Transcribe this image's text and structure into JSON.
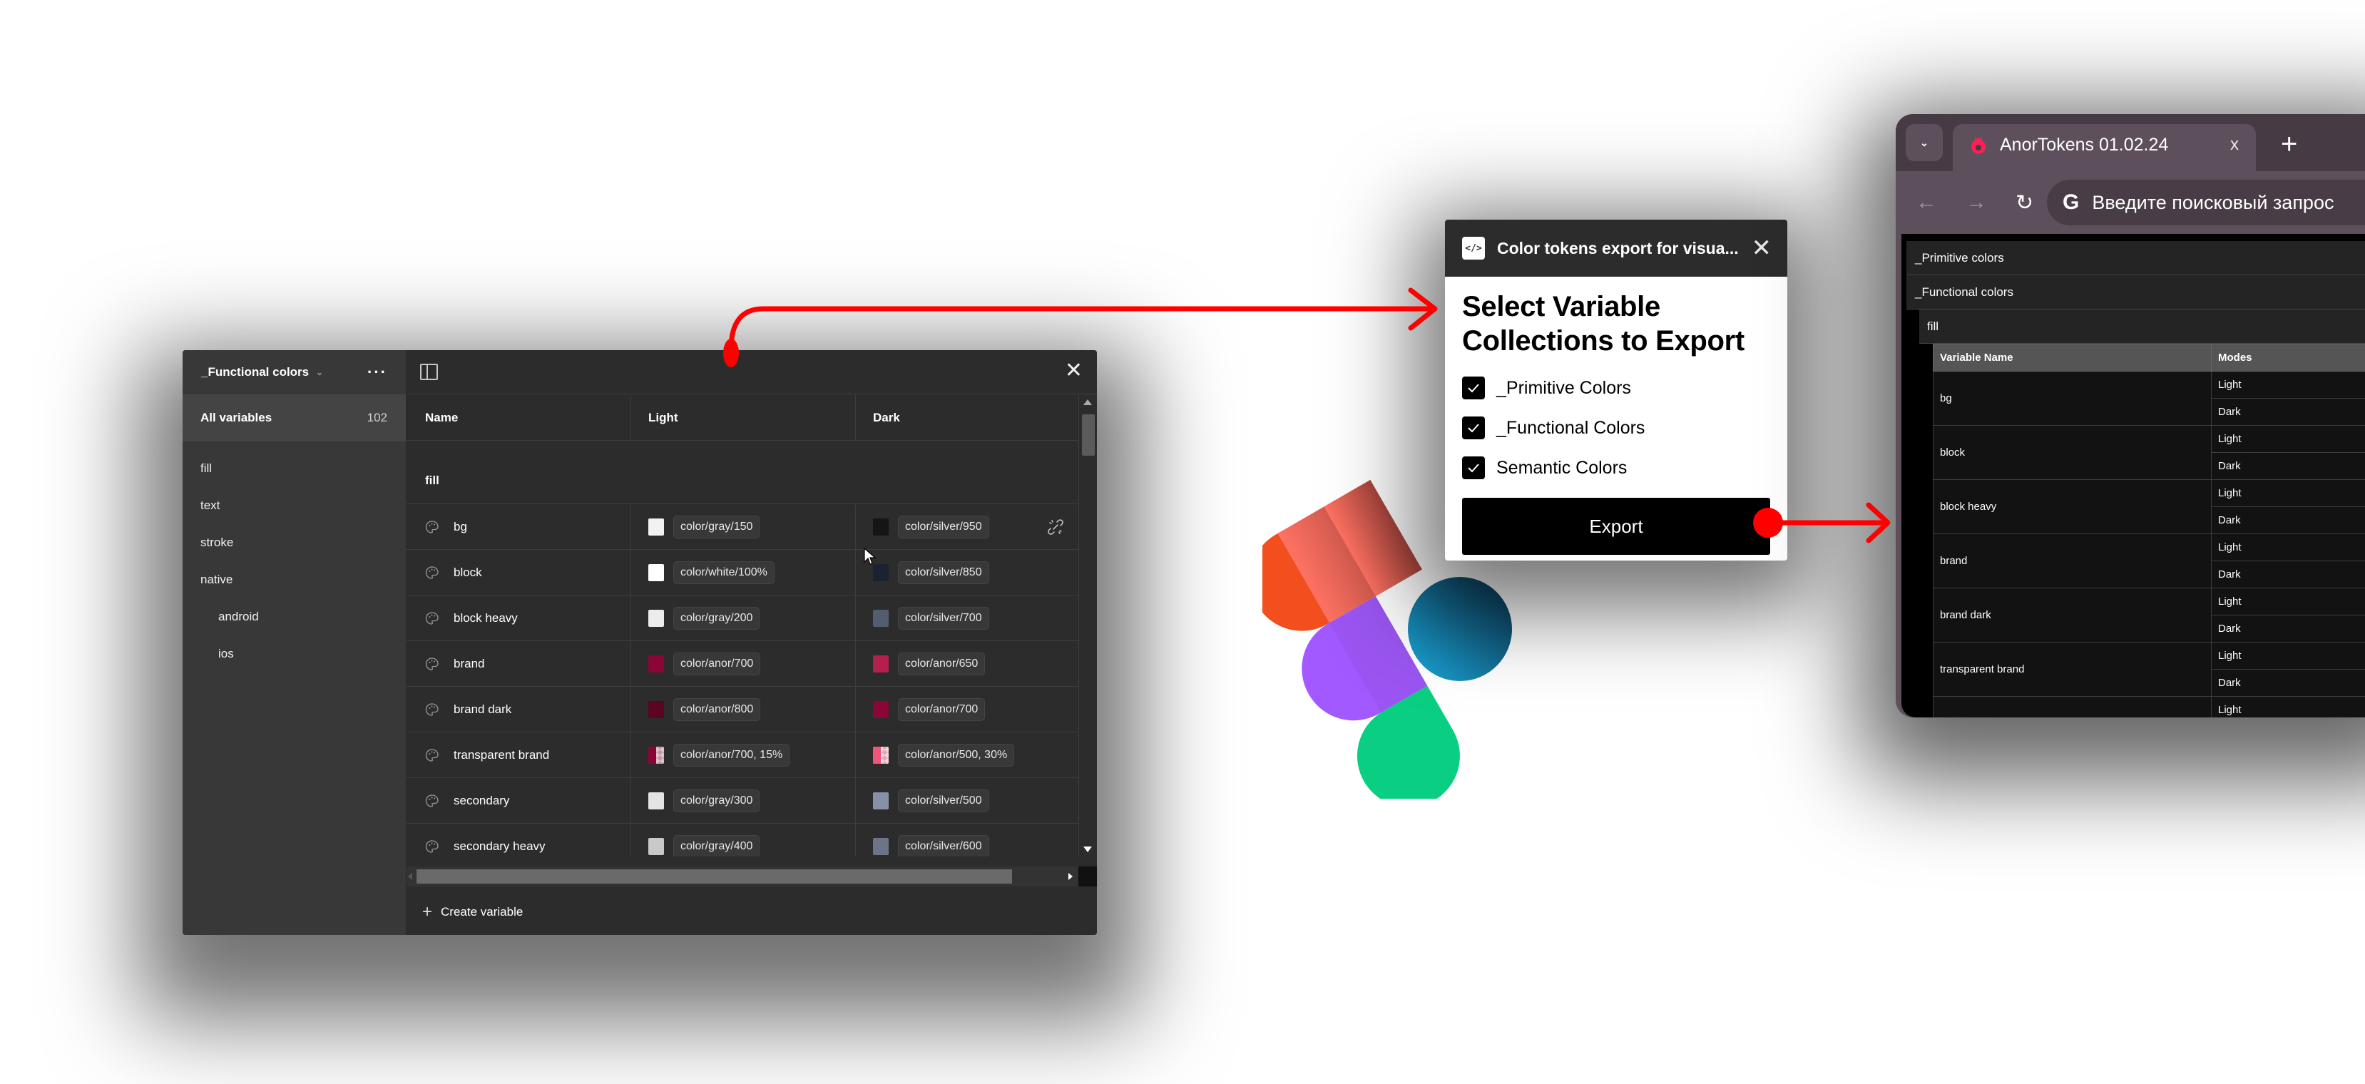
{
  "figma_panel": {
    "collection_name": "_Functional colors",
    "all_variables_label": "All variables",
    "all_variables_count": "102",
    "groups": [
      {
        "label": "fill",
        "level": 0
      },
      {
        "label": "text",
        "level": 0
      },
      {
        "label": "stroke",
        "level": 0
      },
      {
        "label": "native",
        "level": 0
      },
      {
        "label": "android",
        "level": 1
      },
      {
        "label": "ios",
        "level": 1
      }
    ],
    "columns": {
      "name": "Name",
      "light": "Light",
      "dark": "Dark"
    },
    "group_header": "fill",
    "rows": [
      {
        "name": "bg",
        "light": {
          "token": "color/gray/150",
          "swatch": "#f2f2f2"
        },
        "dark": {
          "token": "color/silver/950",
          "swatch": "#151515"
        }
      },
      {
        "name": "block",
        "light": {
          "token": "color/white/100%",
          "swatch": "#ffffff"
        },
        "dark": {
          "token": "color/silver/850",
          "swatch": "#1b2232"
        }
      },
      {
        "name": "block heavy",
        "light": {
          "token": "color/gray/200",
          "swatch": "#ececec"
        },
        "dark": {
          "token": "color/silver/700",
          "swatch": "#545d70"
        }
      },
      {
        "name": "brand",
        "light": {
          "token": "color/anor/700",
          "swatch": "#8a0538"
        },
        "dark": {
          "token": "color/anor/650",
          "swatch": "#b3204e"
        }
      },
      {
        "name": "brand dark",
        "light": {
          "token": "color/anor/800",
          "swatch": "#5c0420"
        },
        "dark": {
          "token": "color/anor/700",
          "swatch": "#8a0538"
        }
      },
      {
        "name": "transparent brand",
        "light": {
          "token": "color/anor/700, 15%",
          "swatch": "#8a0538",
          "transparent": true
        },
        "dark": {
          "token": "color/anor/500, 30%",
          "swatch": "#f0557a",
          "transparent": true
        }
      },
      {
        "name": "secondary",
        "light": {
          "token": "color/gray/300",
          "swatch": "#e4e4e4"
        },
        "dark": {
          "token": "color/silver/500",
          "swatch": "#8791a6"
        }
      },
      {
        "name": "secondary heavy",
        "light": {
          "token": "color/gray/400",
          "swatch": "#c9c9cb"
        },
        "dark": {
          "token": "color/silver/600",
          "swatch": "#6c7487"
        }
      }
    ],
    "create_variable_label": "Create variable"
  },
  "plugin": {
    "title": "Color tokens export for visua...",
    "icon_text": "</>",
    "heading": "Select Variable Collections to Export",
    "collections": [
      {
        "label": "_Primitive Colors",
        "checked": true
      },
      {
        "label": "_Functional Colors",
        "checked": true
      },
      {
        "label": "Semantic Colors",
        "checked": true
      }
    ],
    "export_label": "Export"
  },
  "browser": {
    "tab_title": "AnorTokens 01.02.24",
    "tab_close": "x",
    "new_tab": "+",
    "omnibox_placeholder": "Введите поисковый запрос",
    "google_glyph": "G",
    "collections": [
      "_Primitive colors",
      "_Functional colors"
    ],
    "group": "fill",
    "table_headers": [
      "Variable Name",
      "Modes"
    ],
    "variables": [
      {
        "name": "bg",
        "modes": [
          "Light",
          "Dark"
        ]
      },
      {
        "name": "block",
        "modes": [
          "Light",
          "Dark"
        ]
      },
      {
        "name": "block heavy",
        "modes": [
          "Light",
          "Dark"
        ]
      },
      {
        "name": "brand",
        "modes": [
          "Light",
          "Dark"
        ]
      },
      {
        "name": "brand dark",
        "modes": [
          "Light",
          "Dark"
        ]
      },
      {
        "name": "transparent brand",
        "modes": [
          "Light",
          "Dark"
        ]
      },
      {
        "name": "",
        "modes": [
          "Light"
        ]
      }
    ]
  },
  "colors": {
    "annotation_red": "#ff0000",
    "figma_panel_bg": "#2c2c2c",
    "figma_sidebar_bg": "#383838",
    "browser_chrome": "#5e4f5c",
    "logo_orange": "#f24e1e",
    "logo_coral": "#ff7262",
    "logo_purple": "#a259ff",
    "logo_blue": "#1abcfe",
    "logo_green": "#0acf83"
  }
}
